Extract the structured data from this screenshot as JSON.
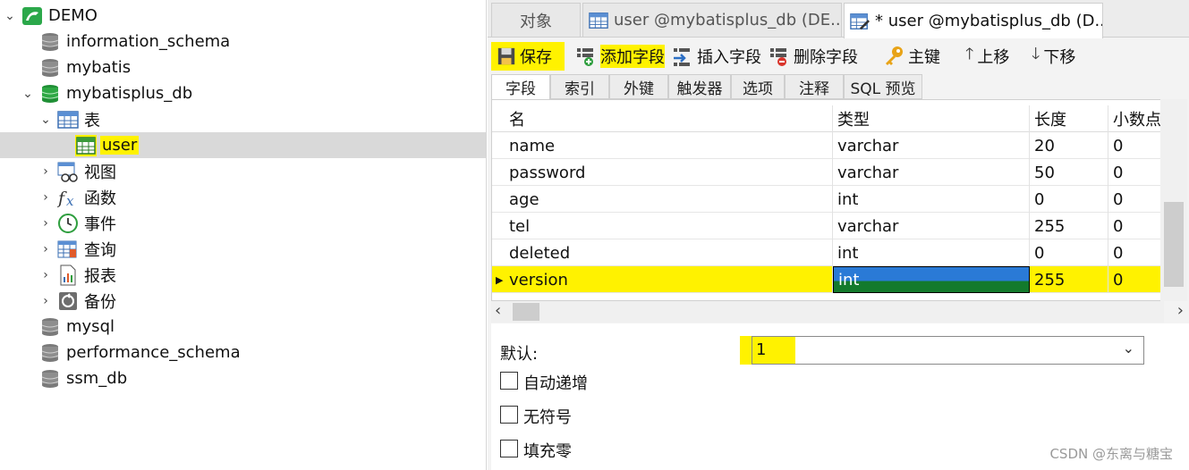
{
  "tree": {
    "connection": "DEMO",
    "databases": [
      {
        "name": "information_schema"
      },
      {
        "name": "mybatis"
      },
      {
        "name": "mybatisplus_db"
      },
      {
        "name": "mysql"
      },
      {
        "name": "performance_schema"
      },
      {
        "name": "ssm_db"
      }
    ],
    "tables_folder": "表",
    "table_user": "user",
    "folders": [
      "视图",
      "函数",
      "事件",
      "查询",
      "报表",
      "备份"
    ]
  },
  "tabs": [
    {
      "label": "对象"
    },
    {
      "label": "user @mybatisplus_db (DE..."
    },
    {
      "label": "* user @mybatisplus_db (D..."
    }
  ],
  "toolbar": {
    "save": "保存",
    "add_field": "添加字段",
    "insert_field": "插入字段",
    "delete_field": "删除字段",
    "primary_key": "主键",
    "move_up": "上移",
    "move_down": "下移"
  },
  "subtabs": [
    "字段",
    "索引",
    "外键",
    "触发器",
    "选项",
    "注释",
    "SQL 预览"
  ],
  "grid": {
    "columns": [
      "名",
      "类型",
      "长度",
      "小数点"
    ],
    "rows": [
      [
        "name",
        "varchar",
        "20",
        "0"
      ],
      [
        "password",
        "varchar",
        "50",
        "0"
      ],
      [
        "age",
        "int",
        "0",
        "0"
      ],
      [
        "tel",
        "varchar",
        "255",
        "0"
      ],
      [
        "deleted",
        "int",
        "0",
        "0"
      ],
      [
        "version",
        "int",
        "255",
        "0"
      ]
    ]
  },
  "props": {
    "default_label": "默认:",
    "default_value": "1",
    "auto_increment": "自动递增",
    "unsigned": "无符号",
    "zerofill": "填充零"
  },
  "watermark": "CSDN @东离与糖宝",
  "colors": {
    "highlight": "#fff200",
    "selection": "#d9d9d9",
    "db_green": "#2e9e3e"
  }
}
